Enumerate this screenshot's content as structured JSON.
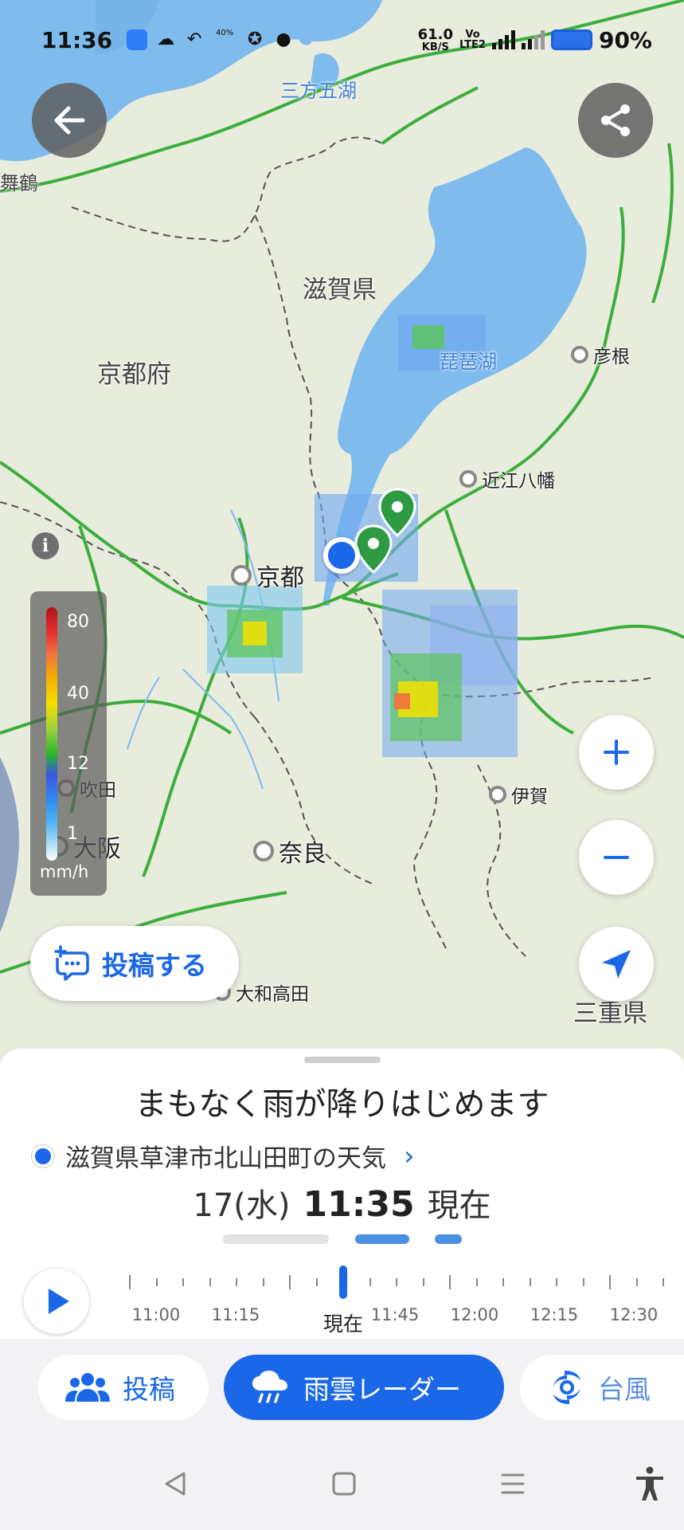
{
  "status_bar": {
    "time": "11:36",
    "net_speed": "61.0",
    "net_unit": "KB/S",
    "volte_top": "Vo",
    "volte_bottom": "LTE2",
    "battery": "90%",
    "notif_weather_pct": "40%"
  },
  "map": {
    "labels": {
      "mikata_goko": "三方五湖",
      "maizuru": "舞鶴",
      "shiga": "滋賀県",
      "kyoto_pref": "京都府",
      "biwako": "琵琶湖",
      "hikone": "彦根",
      "omihachiman": "近江八幡",
      "kyoto": "京都",
      "suita": "吹田",
      "osaka": "大阪",
      "nara": "奈良",
      "iga": "伊賀",
      "yamatotakada": "大和高田",
      "mie": "三重県"
    },
    "legend": {
      "ticks": [
        "80",
        "40",
        "12",
        "1"
      ],
      "unit": "mm/h"
    },
    "info_icon": "i",
    "post_button": "投稿する"
  },
  "sheet": {
    "headline": "まもなく雨が降りはじめます",
    "location": "滋賀県草津市北山田町の天気",
    "date": "17(水)",
    "time": "11:35",
    "now_suffix": "現在",
    "timeline_labels": [
      "11:00",
      "11:15",
      "現在",
      "11:45",
      "12:00",
      "12:15",
      "12:30"
    ]
  },
  "tabs": {
    "post": "投稿",
    "radar": "雨雲レーダー",
    "typhoon": "台風"
  },
  "colors": {
    "accent": "#1a67e8",
    "lake": "#7fbbec",
    "road": "#3cae3c",
    "land": "#e7ecdc"
  }
}
